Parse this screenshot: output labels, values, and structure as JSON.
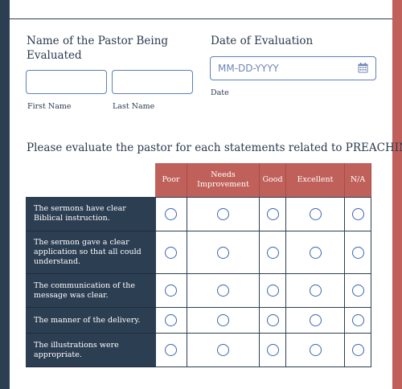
{
  "form": {
    "name_label": "Name of the Pastor Being Evaluated",
    "first_name_sub": "First Name",
    "last_name_sub": "Last Name",
    "date_label": "Date of Evaluation",
    "date_placeholder": "MM-DD-YYYY",
    "date_sub": "Date",
    "icons": {
      "date_picker": "calendar-icon"
    }
  },
  "question": "Please evaluate the pastor for each statements related to PREACHING.",
  "matrix": {
    "columns": [
      "Poor",
      "Needs Improvement",
      "Good",
      "Excellent",
      "N/A"
    ],
    "rows": [
      "The sermons have clear Biblical instruction.",
      "The sermon gave a clear application so that all could understand.",
      "The communication of the message was clear.",
      "The manner of the delivery.",
      "The illustrations were appropriate."
    ]
  },
  "colors": {
    "navy": "#2c3e52",
    "accent": "#c0605a",
    "input_border": "#5b7fbf"
  }
}
